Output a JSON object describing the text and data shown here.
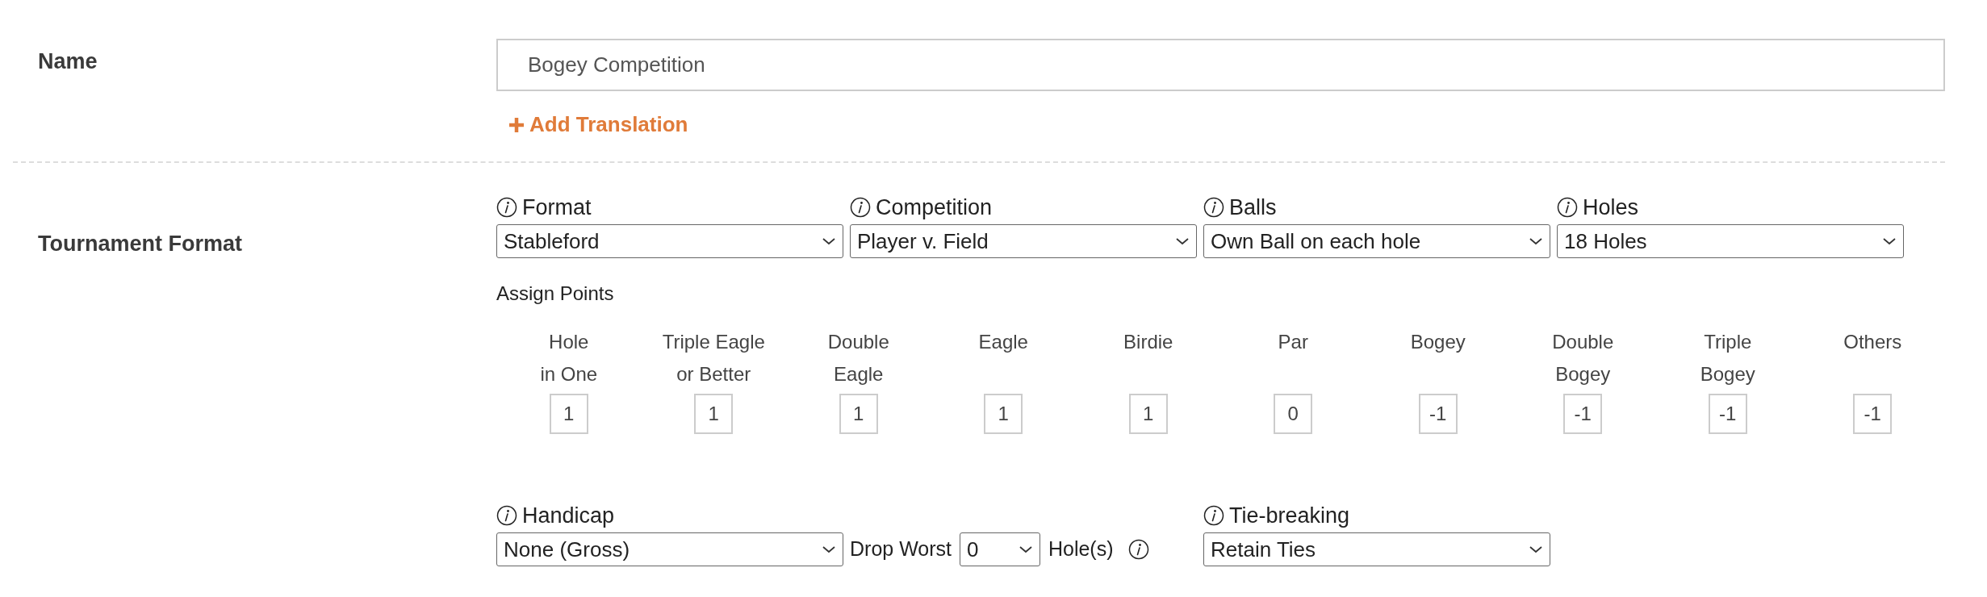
{
  "name_field": {
    "label": "Name",
    "value": "Bogey Competition",
    "add_translation": "Add Translation"
  },
  "tournament_format": {
    "label": "Tournament Format",
    "selects": [
      {
        "label": "Format",
        "value": "Stableford"
      },
      {
        "label": "Competition",
        "value": "Player v. Field"
      },
      {
        "label": "Balls",
        "value": "Own Ball on each hole"
      },
      {
        "label": "Holes",
        "value": "18 Holes"
      }
    ],
    "assign_points": {
      "label": "Assign Points",
      "columns": [
        {
          "label": [
            "Hole",
            "in One"
          ],
          "value": "1"
        },
        {
          "label": [
            "Triple Eagle",
            "or Better"
          ],
          "value": "1"
        },
        {
          "label": [
            "Double",
            "Eagle"
          ],
          "value": "1"
        },
        {
          "label": [
            "Eagle"
          ],
          "value": "1"
        },
        {
          "label": [
            "Birdie"
          ],
          "value": "1"
        },
        {
          "label": [
            "Par"
          ],
          "value": "0"
        },
        {
          "label": [
            "Bogey"
          ],
          "value": "-1"
        },
        {
          "label": [
            "Double",
            "Bogey"
          ],
          "value": "-1"
        },
        {
          "label": [
            "Triple",
            "Bogey"
          ],
          "value": "-1"
        },
        {
          "label": [
            "Others"
          ],
          "value": "-1"
        }
      ]
    },
    "handicap": {
      "label": "Handicap",
      "value": "None (Gross)"
    },
    "drop_worst": {
      "label": "Drop Worst",
      "value": "0",
      "suffix": "Hole(s)"
    },
    "tie_breaking": {
      "label": "Tie-breaking",
      "value": "Retain Ties"
    }
  }
}
